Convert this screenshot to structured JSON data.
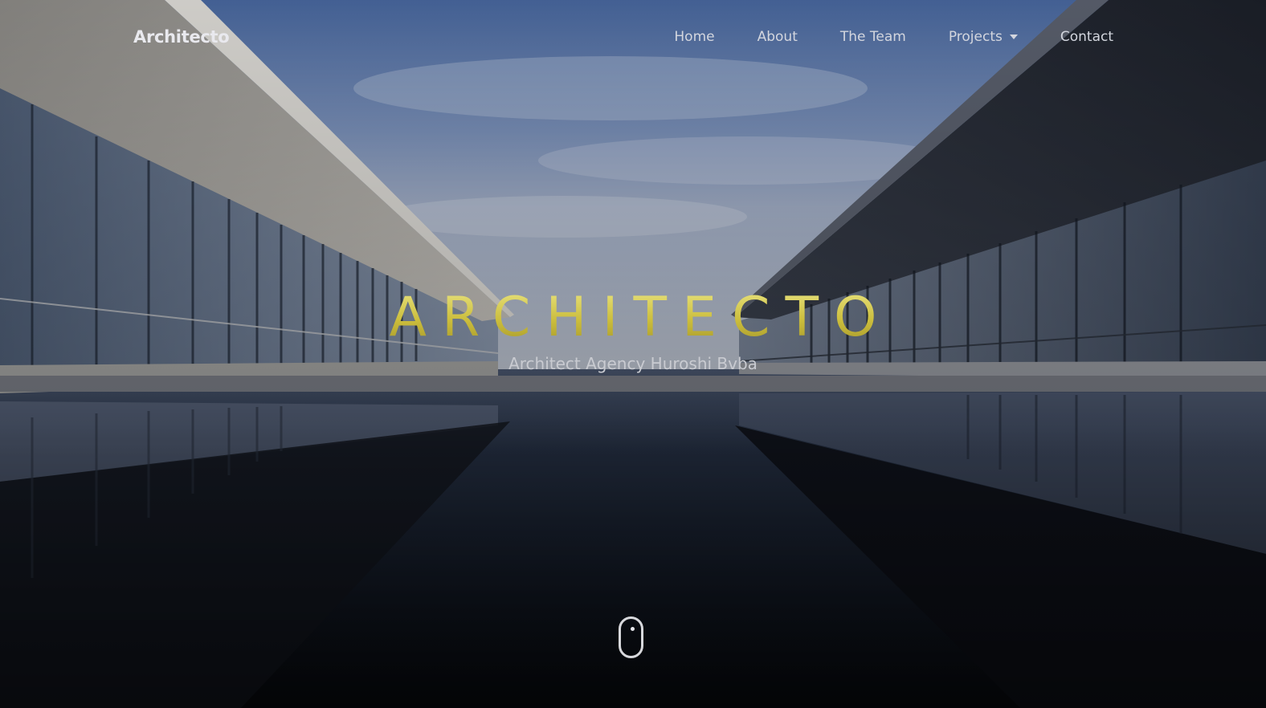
{
  "brand": {
    "name": "Architecto"
  },
  "nav": {
    "items": [
      {
        "label": "Home"
      },
      {
        "label": "About"
      },
      {
        "label": "The Team"
      },
      {
        "label": "Projects"
      },
      {
        "label": "Contact"
      }
    ]
  },
  "hero": {
    "title": "ARCHITECTO",
    "subtitle": "Architect Agency Huroshi Bvba",
    "scroll_icon": "mouse-scroll-icon"
  },
  "colors": {
    "title_gold": "#d6cc55",
    "nav_text": "#d3d6de",
    "sky": "#6f86b3",
    "water": "#0f141d"
  }
}
